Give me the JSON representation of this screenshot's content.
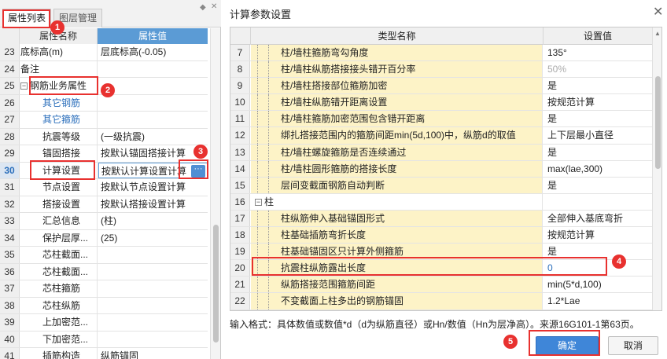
{
  "left_panel": {
    "tabs": [
      "属性列表",
      "图层管理"
    ],
    "pin_icon": "◆",
    "close_icon": "✕",
    "header": {
      "name": "属性名称",
      "value": "属性值"
    },
    "rows": [
      {
        "num": "23",
        "name": "底标高(m)",
        "value": "层底标高(-0.05)"
      },
      {
        "num": "24",
        "name": "备注",
        "value": ""
      },
      {
        "num": "25",
        "name": "钢筋业务属性",
        "value": "",
        "toggle": "−"
      },
      {
        "num": "26",
        "name": "其它钢筋",
        "value": ""
      },
      {
        "num": "27",
        "name": "其它箍筋",
        "value": ""
      },
      {
        "num": "28",
        "name": "抗震等级",
        "value": "(一级抗震)"
      },
      {
        "num": "29",
        "name": "锚固搭接",
        "value": "按默认锚固搭接计算"
      },
      {
        "num": "30",
        "name": "计算设置",
        "value": "按默认计算设置计算"
      },
      {
        "num": "31",
        "name": "节点设置",
        "value": "按默认节点设置计算"
      },
      {
        "num": "32",
        "name": "搭接设置",
        "value": "按默认搭接设置计算"
      },
      {
        "num": "33",
        "name": "汇总信息",
        "value": "(柱)"
      },
      {
        "num": "34",
        "name": "保护层厚...",
        "value": "(25)"
      },
      {
        "num": "35",
        "name": "芯柱截面...",
        "value": ""
      },
      {
        "num": "36",
        "name": "芯柱截面...",
        "value": ""
      },
      {
        "num": "37",
        "name": "芯柱箍筋",
        "value": ""
      },
      {
        "num": "38",
        "name": "芯柱纵筋",
        "value": ""
      },
      {
        "num": "39",
        "name": "上加密范...",
        "value": ""
      },
      {
        "num": "40",
        "name": "下加密范...",
        "value": ""
      },
      {
        "num": "41",
        "name": "插筋构造",
        "value": "纵筋锚固"
      }
    ],
    "ellipsis": "···"
  },
  "dialog": {
    "title": "计算参数设置",
    "close_icon": "✕",
    "header": {
      "name": "类型名称",
      "value": "设置值"
    },
    "rows": [
      {
        "num": "7",
        "name": "柱/墙柱箍筋弯勾角度",
        "value": "135°",
        "level": 2
      },
      {
        "num": "8",
        "name": "柱/墙柱纵筋搭接接头错开百分率",
        "value": "50%",
        "level": 2
      },
      {
        "num": "9",
        "name": "柱/墙柱搭接部位箍筋加密",
        "value": "是",
        "level": 2
      },
      {
        "num": "10",
        "name": "柱/墙柱纵筋错开距离设置",
        "value": "按规范计算",
        "level": 2
      },
      {
        "num": "11",
        "name": "柱/墙柱箍筋加密范围包含错开距离",
        "value": "是",
        "level": 2
      },
      {
        "num": "12",
        "name": "绑扎搭接范围内的箍筋间距min(5d,100)中，纵筋d的取值",
        "value": "上下层最小直径",
        "level": 2
      },
      {
        "num": "13",
        "name": "柱/墙柱螺旋箍筋是否连续通过",
        "value": "是",
        "level": 2
      },
      {
        "num": "14",
        "name": "柱/墙柱圆形箍筋的搭接长度",
        "value": "max(lae,300)",
        "level": 2
      },
      {
        "num": "15",
        "name": "层间变截面钢筋自动判断",
        "value": "是",
        "level": 2
      },
      {
        "num": "16",
        "name": "柱",
        "value": "",
        "level": 1,
        "toggle": "−"
      },
      {
        "num": "17",
        "name": "柱纵筋伸入基础锚固形式",
        "value": "全部伸入基底弯折",
        "level": 2
      },
      {
        "num": "18",
        "name": "柱基础插筋弯折长度",
        "value": "按规范计算",
        "level": 2
      },
      {
        "num": "19",
        "name": "柱基础锚固区只计算外侧箍筋",
        "value": "是",
        "level": 2
      },
      {
        "num": "20",
        "name": "抗震柱纵筋露出长度",
        "value": "0",
        "level": 2
      },
      {
        "num": "21",
        "name": "纵筋搭接范围箍筋间距",
        "value": "min(5*d,100)",
        "level": 2
      },
      {
        "num": "22",
        "name": "不变截面上柱多出的钢筋锚固",
        "value": "1.2*Lae",
        "level": 2
      }
    ],
    "hint": "输入格式：具体数值或数值*d（d为纵筋直径）或Hn/数值（Hn为层净高）。来源16G101-1第63页。",
    "ok_label": "确定",
    "cancel_label": "取消",
    "scroll_up": "▲"
  },
  "annotations": [
    "1",
    "2",
    "3",
    "4",
    "5"
  ]
}
